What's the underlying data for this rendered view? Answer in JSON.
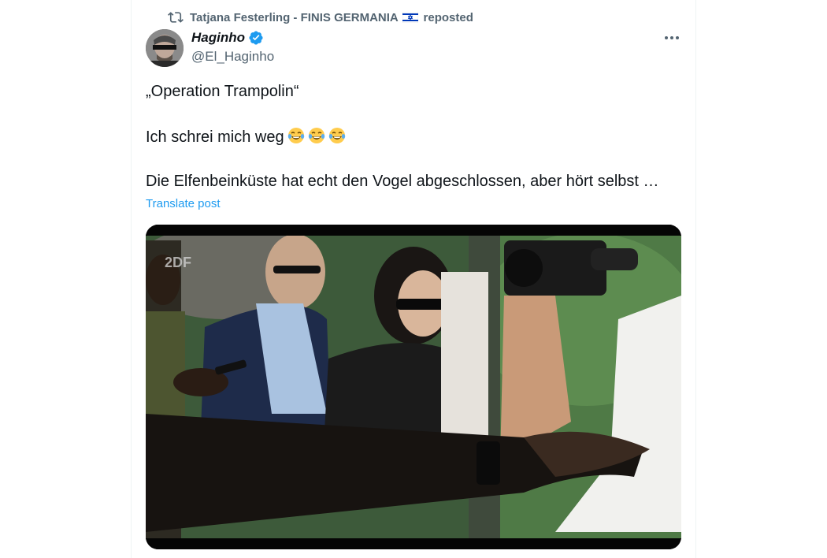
{
  "repost": {
    "name": "Tatjana Festerling - FINIS GERMANIA",
    "suffix": "reposted",
    "icon": "repost-icon",
    "flag": "israel-flag"
  },
  "author": {
    "display_name": "Haginho",
    "handle": "@El_Haginho",
    "verified_icon": "verified-badge-icon",
    "verified_color": "#1d9bf0"
  },
  "menu_icon": "more-options-icon",
  "post": {
    "line1": "„Operation Trampolin“",
    "line2": "Ich schrei mich weg",
    "emoji": "face-with-tears-of-joy",
    "emoji_count": 3,
    "line3": "Die Elfenbeinküste hat echt den Vogel abgeschlossen, aber hört selbst …"
  },
  "translate_label": "Translate post",
  "media": {
    "type": "video",
    "watermark": "2DF"
  },
  "colors": {
    "text": "#0f1419",
    "secondary": "#536471",
    "link": "#1d9bf0"
  }
}
